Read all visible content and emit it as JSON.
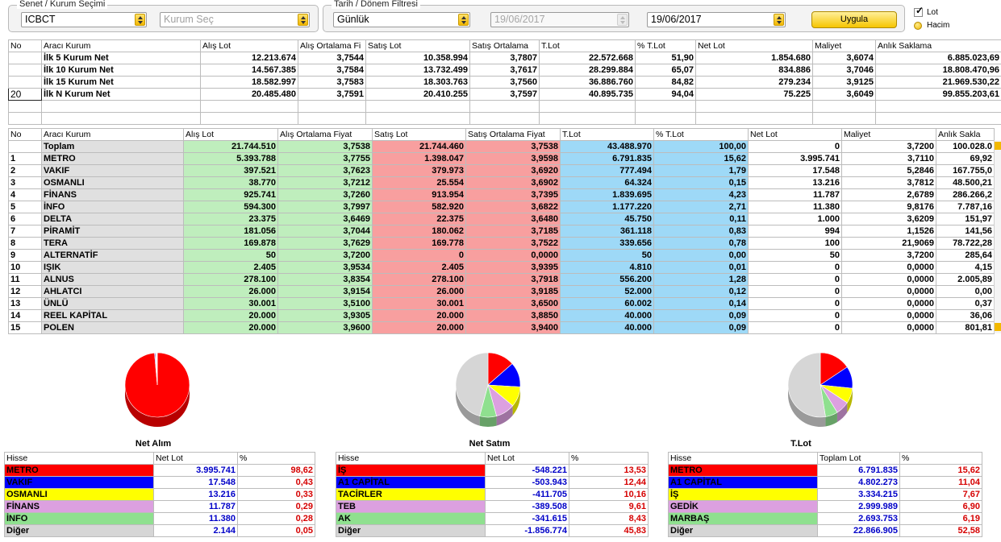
{
  "filters": {
    "symbol_legend": "Senet / Kurum Seçimi",
    "symbol_value": "ICBCT",
    "broker_placeholder": "Kurum Seç",
    "date_legend": "Tarih / Dönem Filtresi",
    "period_value": "Günlük",
    "date_from": "19/06/2017",
    "date_to": "19/06/2017",
    "apply_label": "Uygula",
    "lot_label": "Lot",
    "volume_label": "Hacim"
  },
  "summary": {
    "headers": [
      "No",
      "Aracı Kurum",
      "Alış Lot",
      "Alış Ortalama Fi",
      "Satış Lot",
      "Satış Ortalama",
      "T.Lot",
      "% T.Lot",
      "Net Lot",
      "Maliyet",
      "Anlık Saklama"
    ],
    "n_value": "20",
    "rows": [
      [
        "",
        "İlk 5 Kurum Net",
        "12.213.674",
        "3,7544",
        "10.358.994",
        "3,7807",
        "22.572.668",
        "51,90",
        "1.854.680",
        "3,6074",
        "6.885.023,69"
      ],
      [
        "",
        "İlk 10 Kurum Net",
        "14.567.385",
        "3,7584",
        "13.732.499",
        "3,7617",
        "28.299.884",
        "65,07",
        "834.886",
        "3,7046",
        "18.808.470,96"
      ],
      [
        "",
        "İlk 15 Kurum Net",
        "18.582.997",
        "3,7583",
        "18.303.763",
        "3,7560",
        "36.886.760",
        "84,82",
        "279.234",
        "3,9125",
        "21.969.530,22"
      ],
      [
        "",
        "İlk N Kurum Net",
        "20.485.480",
        "3,7591",
        "20.410.255",
        "3,7597",
        "40.895.735",
        "94,04",
        "75.225",
        "3,6049",
        "99.855.203,61"
      ]
    ]
  },
  "detail": {
    "headers": [
      "No",
      "Aracı Kurum",
      "Alış Lot",
      "Alış Ortalama Fiyat",
      "Satış Lot",
      "Satış Ortalama Fiyat",
      "T.Lot",
      "% T.Lot",
      "Net Lot",
      "Maliyet",
      "Anlık Sakla"
    ],
    "total": [
      "",
      "Toplam",
      "21.744.510",
      "3,7538",
      "21.744.460",
      "3,7538",
      "43.488.970",
      "100,00",
      "0",
      "3,7200",
      "100.028.0"
    ],
    "rows": [
      [
        "1",
        "METRO",
        "5.393.788",
        "3,7755",
        "1.398.047",
        "3,9598",
        "6.791.835",
        "15,62",
        "3.995.741",
        "3,7110",
        "69,92"
      ],
      [
        "2",
        "VAKIF",
        "397.521",
        "3,7623",
        "379.973",
        "3,6920",
        "777.494",
        "1,79",
        "17.548",
        "5,2846",
        "167.755,0"
      ],
      [
        "3",
        "OSMANLI",
        "38.770",
        "3,7212",
        "25.554",
        "3,6902",
        "64.324",
        "0,15",
        "13.216",
        "3,7812",
        "48.500,21"
      ],
      [
        "4",
        "FİNANS",
        "925.741",
        "3,7260",
        "913.954",
        "3,7395",
        "1.839.695",
        "4,23",
        "11.787",
        "2,6789",
        "286.266,2"
      ],
      [
        "5",
        "İNFO",
        "594.300",
        "3,7997",
        "582.920",
        "3,6822",
        "1.177.220",
        "2,71",
        "11.380",
        "9,8176",
        "7.787,16"
      ],
      [
        "6",
        "DELTA",
        "23.375",
        "3,6469",
        "22.375",
        "3,6480",
        "45.750",
        "0,11",
        "1.000",
        "3,6209",
        "151,97"
      ],
      [
        "7",
        "PİRAMİT",
        "181.056",
        "3,7044",
        "180.062",
        "3,7185",
        "361.118",
        "0,83",
        "994",
        "1,1526",
        "141,56"
      ],
      [
        "8",
        "TERA",
        "169.878",
        "3,7629",
        "169.778",
        "3,7522",
        "339.656",
        "0,78",
        "100",
        "21,9069",
        "78.722,28"
      ],
      [
        "9",
        "ALTERNATİF",
        "50",
        "3,7200",
        "0",
        "0,0000",
        "50",
        "0,00",
        "50",
        "3,7200",
        "285,64"
      ],
      [
        "10",
        "IŞIK",
        "2.405",
        "3,9534",
        "2.405",
        "3,9395",
        "4.810",
        "0,01",
        "0",
        "0,0000",
        "4,15"
      ],
      [
        "11",
        "ALNUS",
        "278.100",
        "3,8354",
        "278.100",
        "3,7918",
        "556.200",
        "1,28",
        "0",
        "0,0000",
        "2.005,89"
      ],
      [
        "12",
        "AHLATCI",
        "26.000",
        "3,9154",
        "26.000",
        "3,9185",
        "52.000",
        "0,12",
        "0",
        "0,0000",
        "0,00"
      ],
      [
        "13",
        "ÜNLÜ",
        "30.001",
        "3,5100",
        "30.001",
        "3,6500",
        "60.002",
        "0,14",
        "0",
        "0,0000",
        "0,37"
      ],
      [
        "14",
        "REEL KAPİTAL",
        "20.000",
        "3,9305",
        "20.000",
        "3,8850",
        "40.000",
        "0,09",
        "0",
        "0,0000",
        "36,06"
      ],
      [
        "15",
        "POLEN",
        "20.000",
        "3,9600",
        "20.000",
        "3,9400",
        "40.000",
        "0,09",
        "0",
        "0,0000",
        "801,81"
      ]
    ]
  },
  "panels": [
    {
      "title": "Net Alım",
      "headers": [
        "Hisse",
        "Net Lot",
        "%"
      ],
      "rows": [
        {
          "name": "METRO",
          "value": "3.995.741",
          "pct": "98,62",
          "color": "#ff0000",
          "share": 98.62
        },
        {
          "name": "VAKIF",
          "value": "17.548",
          "pct": "0,43",
          "color": "#0000ff",
          "share": 0.43
        },
        {
          "name": "OSMANLI",
          "value": "13.216",
          "pct": "0,33",
          "color": "#ffff00",
          "share": 0.33
        },
        {
          "name": "FİNANS",
          "value": "11.787",
          "pct": "0,29",
          "color": "#dca0e0",
          "share": 0.29
        },
        {
          "name": "İNFO",
          "value": "11.380",
          "pct": "0,28",
          "color": "#8fe08f",
          "share": 0.28
        },
        {
          "name": "Diğer",
          "value": "2.144",
          "pct": "0,05",
          "color": "#d6d6d6",
          "share": 0.05
        }
      ]
    },
    {
      "title": "Net Satım",
      "headers": [
        "Hisse",
        "Net Lot",
        "%"
      ],
      "rows": [
        {
          "name": "İŞ",
          "value": "-548.221",
          "pct": "13,53",
          "color": "#ff0000",
          "share": 13.53
        },
        {
          "name": "A1 CAPİTAL",
          "value": "-503.943",
          "pct": "12,44",
          "color": "#0000ff",
          "share": 12.44
        },
        {
          "name": "TACİRLER",
          "value": "-411.705",
          "pct": "10,16",
          "color": "#ffff00",
          "share": 10.16
        },
        {
          "name": "TEB",
          "value": "-389.508",
          "pct": "9,61",
          "color": "#dca0e0",
          "share": 9.61
        },
        {
          "name": "AK",
          "value": "-341.615",
          "pct": "8,43",
          "color": "#8fe08f",
          "share": 8.43
        },
        {
          "name": "Diğer",
          "value": "-1.856.774",
          "pct": "45,83",
          "color": "#d6d6d6",
          "share": 45.83
        }
      ]
    },
    {
      "title": "T.Lot",
      "headers": [
        "Hisse",
        "Toplam Lot",
        "%"
      ],
      "rows": [
        {
          "name": "METRO",
          "value": "6.791.835",
          "pct": "15,62",
          "color": "#ff0000",
          "share": 15.62
        },
        {
          "name": "A1 CAPİTAL",
          "value": "4.802.273",
          "pct": "11,04",
          "color": "#0000ff",
          "share": 11.04
        },
        {
          "name": "İŞ",
          "value": "3.334.215",
          "pct": "7,67",
          "color": "#ffff00",
          "share": 7.67
        },
        {
          "name": "GEDİK",
          "value": "2.999.989",
          "pct": "6,90",
          "color": "#dca0e0",
          "share": 6.9
        },
        {
          "name": "MARBAŞ",
          "value": "2.693.753",
          "pct": "6,19",
          "color": "#8fe08f",
          "share": 6.19
        },
        {
          "name": "Diğer",
          "value": "22.866.905",
          "pct": "52,58",
          "color": "#d6d6d6",
          "share": 52.58
        }
      ]
    }
  ]
}
